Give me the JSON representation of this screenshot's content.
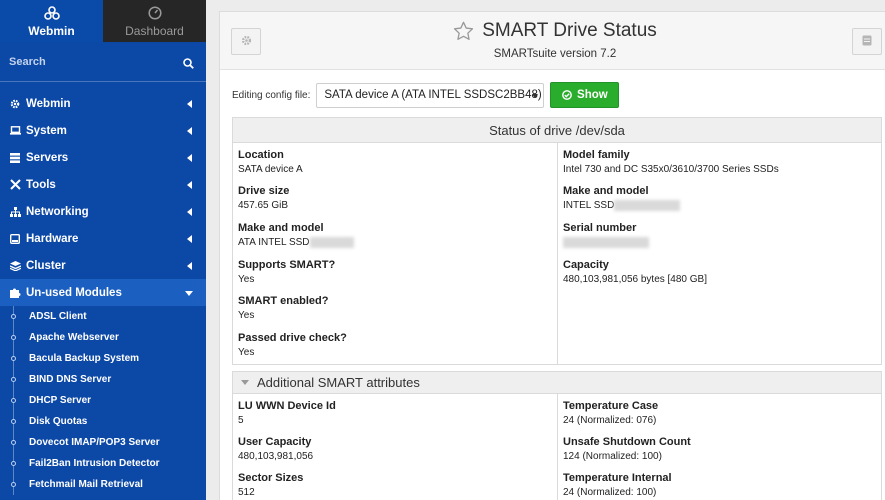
{
  "sidebar": {
    "tabs": [
      {
        "label": "Webmin",
        "icon": "webmin-logo-icon"
      },
      {
        "label": "Dashboard",
        "icon": "dashboard-gauge-icon"
      }
    ],
    "search": {
      "placeholder": "Search",
      "icon": "search-icon"
    },
    "menu": [
      {
        "label": "Webmin",
        "icon": "gear-icon"
      },
      {
        "label": "System",
        "icon": "laptop-icon"
      },
      {
        "label": "Servers",
        "icon": "server-icon"
      },
      {
        "label": "Tools",
        "icon": "tools-icon"
      },
      {
        "label": "Networking",
        "icon": "network-icon"
      },
      {
        "label": "Hardware",
        "icon": "hdd-icon"
      },
      {
        "label": "Cluster",
        "icon": "stack-icon"
      },
      {
        "label": "Un-used Modules",
        "icon": "puzzle-icon"
      }
    ],
    "submenu": [
      "ADSL Client",
      "Apache Webserver",
      "Bacula Backup System",
      "BIND DNS Server",
      "DHCP Server",
      "Disk Quotas",
      "Dovecot IMAP/POP3 Server",
      "Fail2Ban Intrusion Detector",
      "Fetchmail Mail Retrieval"
    ]
  },
  "header": {
    "title": "SMART Drive Status",
    "subtitle": "SMARTsuite version 7.2",
    "left_button_icon": "gear-icon",
    "right_button_icon": "database-icon",
    "star_icon": "star-outline-icon"
  },
  "config": {
    "label": "Editing config file:",
    "selected": "SATA device A (ATA INTEL SSDSC2BB48)",
    "show_button": "Show"
  },
  "status": {
    "heading": "Status of drive /dev/sda",
    "left": [
      {
        "key": "Location",
        "value": "SATA device A"
      },
      {
        "key": "Drive size",
        "value": "457.65 GiB"
      },
      {
        "key": "Make and model",
        "value": "ATA INTEL SSD"
      },
      {
        "key": "Supports SMART?",
        "value": "Yes"
      },
      {
        "key": "SMART enabled?",
        "value": "Yes"
      },
      {
        "key": "Passed drive check?",
        "value": "Yes"
      }
    ],
    "right": [
      {
        "key": "Model family",
        "value": "Intel 730 and DC S35x0/3610/3700 Series SSDs"
      },
      {
        "key": "Make and model",
        "value": "INTEL SSD"
      },
      {
        "key": "Serial number",
        "value": ""
      },
      {
        "key": "Capacity",
        "value": "480,103,981,056 bytes [480 GB]"
      }
    ]
  },
  "attributes": {
    "heading": "Additional SMART attributes",
    "left": [
      {
        "key": "LU WWN Device Id",
        "value": "5"
      },
      {
        "key": "User Capacity",
        "value": "480,103,981,056"
      },
      {
        "key": "Sector Sizes",
        "value": "512"
      }
    ],
    "right": [
      {
        "key": "Temperature Case",
        "value": "24 (Normalized: 076)"
      },
      {
        "key": "Unsafe Shutdown Count",
        "value": "124 (Normalized: 100)"
      },
      {
        "key": "Temperature Internal",
        "value": "24 (Normalized: 100)"
      }
    ]
  },
  "colors": {
    "sidebar": "#0c48a6",
    "sidebar_active": "#1b5fc1",
    "dashboard_tab": "#262626",
    "show_button": "#2aad2c"
  }
}
